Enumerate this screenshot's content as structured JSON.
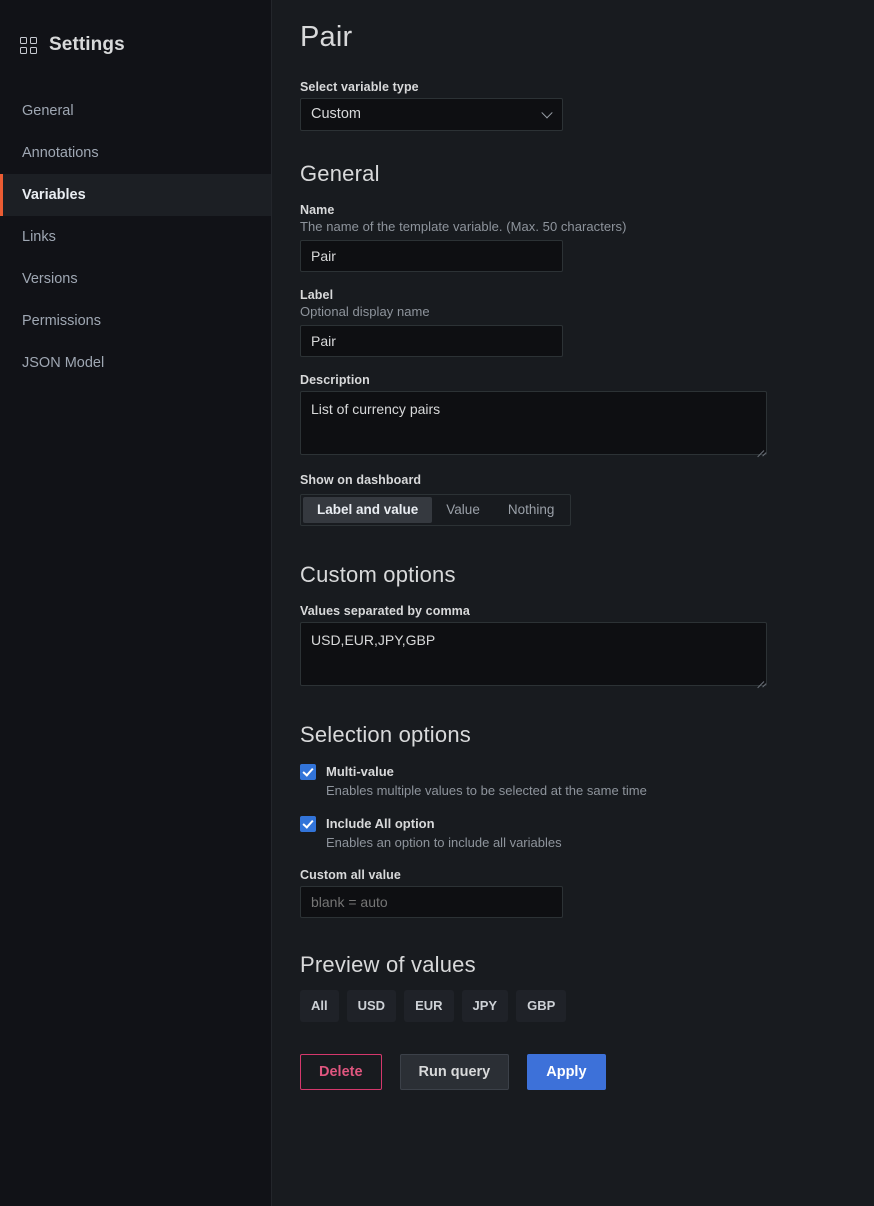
{
  "sidebar": {
    "icon": "grid-icon",
    "title": "Settings",
    "items": [
      {
        "label": "General",
        "active": false
      },
      {
        "label": "Annotations",
        "active": false
      },
      {
        "label": "Variables",
        "active": true
      },
      {
        "label": "Links",
        "active": false
      },
      {
        "label": "Versions",
        "active": false
      },
      {
        "label": "Permissions",
        "active": false
      },
      {
        "label": "JSON Model",
        "active": false
      }
    ],
    "active_accent_color": "#eb5c33"
  },
  "main": {
    "page_title": "Pair",
    "variable_type": {
      "label": "Select variable type",
      "value": "Custom",
      "chevron": "chevron-down-icon"
    },
    "general": {
      "heading": "General",
      "name": {
        "label": "Name",
        "description": "The name of the template variable. (Max. 50 characters)",
        "value": "Pair"
      },
      "label_field": {
        "label": "Label",
        "description": "Optional display name",
        "value": "Pair"
      },
      "description_field": {
        "label": "Description",
        "value": "List of currency pairs"
      },
      "show_on_dashboard": {
        "label": "Show on dashboard",
        "options": [
          "Label and value",
          "Value",
          "Nothing"
        ],
        "selected": "Label and value"
      }
    },
    "custom_options": {
      "heading": "Custom options",
      "values_field": {
        "label": "Values separated by comma",
        "value": "USD,EUR,JPY,GBP"
      }
    },
    "selection_options": {
      "heading": "Selection options",
      "multi_value": {
        "label": "Multi-value",
        "description": "Enables multiple values to be selected at the same time",
        "checked": true
      },
      "include_all": {
        "label": "Include All option",
        "description": "Enables an option to include all variables",
        "checked": true
      },
      "custom_all_value": {
        "label": "Custom all value",
        "value": "",
        "placeholder": "blank = auto"
      }
    },
    "preview": {
      "heading": "Preview of values",
      "chips": [
        "All",
        "USD",
        "EUR",
        "JPY",
        "GBP"
      ]
    },
    "buttons": {
      "delete": "Delete",
      "run_query": "Run query",
      "apply": "Apply"
    },
    "colors": {
      "primary": "#3d71d9",
      "danger": "#d4386c",
      "checkbox": "#3274d9"
    }
  }
}
